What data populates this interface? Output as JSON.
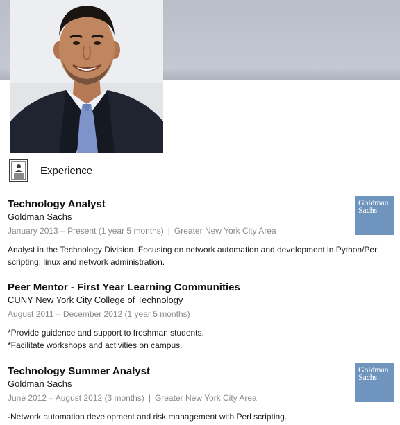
{
  "profile": {
    "photo_alt": "profile photo"
  },
  "section": {
    "title": "Experience",
    "icon": "resume-document-icon"
  },
  "experience": [
    {
      "title": "Technology Analyst",
      "organization": "Goldman Sachs",
      "dates": "January 2013 – Present (1 year 5 months)",
      "location": "Greater New York City Area",
      "description": [
        "Analyst in the Technology Division. Focusing on network automation and development in Python/Perl",
        "scripting, linux and network administration."
      ],
      "logo_line1": "Goldman",
      "logo_line2": "Sachs"
    },
    {
      "title": "Peer Mentor - First Year Learning Communities",
      "organization": "CUNY New York City College of Technology",
      "dates": "August 2011 – December 2012 (1 year 5 months)",
      "description": [
        "*Provide guidence and support to freshman students.",
        "*Facilitate workshops and activities on campus."
      ]
    },
    {
      "title": "Technology Summer Analyst",
      "organization": "Goldman Sachs",
      "dates": "June 2012 – August 2012 (3 months)",
      "location": "Greater New York City Area",
      "description": [
        "-Network automation development and risk management with Perl scripting."
      ],
      "logo_line1": "Goldman",
      "logo_line2": "Sachs"
    }
  ],
  "separator": "|",
  "colors": {
    "banner": "#bcc1cb",
    "logo_bg": "#6f95bf",
    "meta_text": "#8a8a8a"
  }
}
